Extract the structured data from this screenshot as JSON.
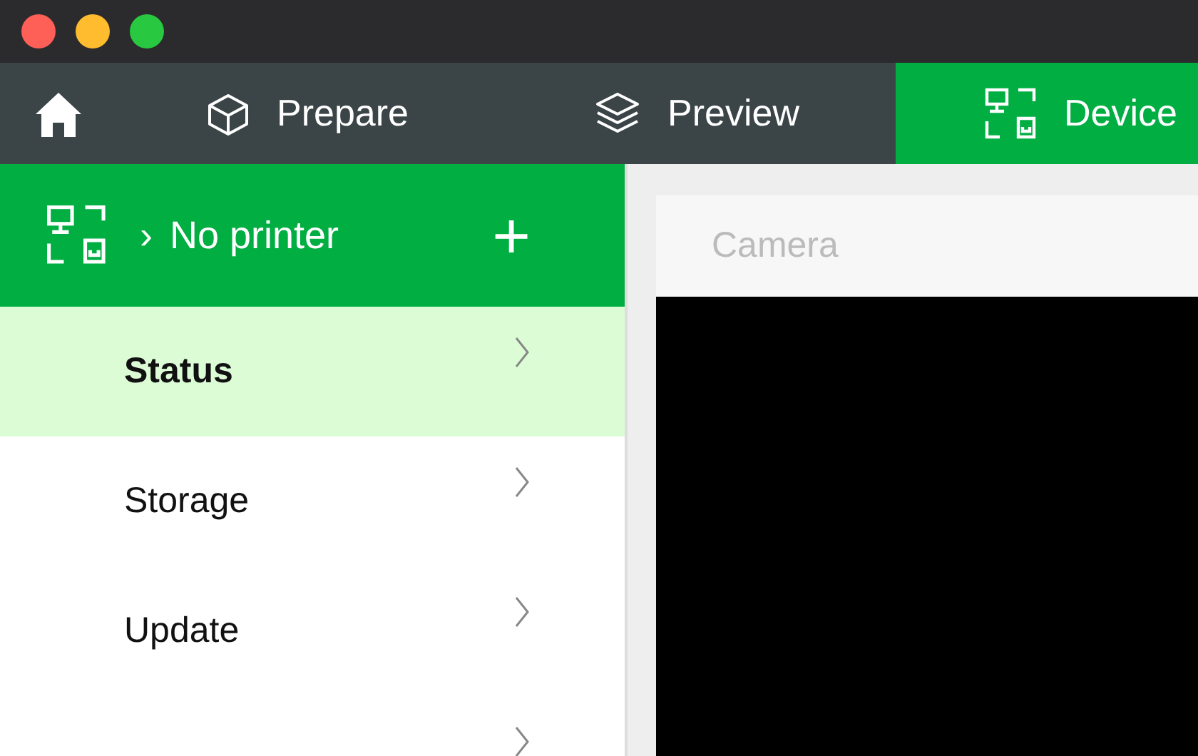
{
  "tabs": [
    {
      "kind": "home",
      "selected": false
    },
    {
      "kind": "prepare",
      "label": "Prepare",
      "selected": false
    },
    {
      "kind": "preview",
      "label": "Preview",
      "selected": false
    },
    {
      "kind": "device",
      "label": "Device",
      "selected": true
    }
  ],
  "printer": {
    "chevron": "›",
    "name": "No printer",
    "add": "+"
  },
  "sidebar": {
    "items": [
      {
        "label": "Status",
        "selected": true
      },
      {
        "label": "Storage",
        "selected": false
      },
      {
        "label": "Update",
        "selected": false
      },
      {
        "selected": false
      }
    ]
  },
  "camera": {
    "title": "Camera"
  }
}
